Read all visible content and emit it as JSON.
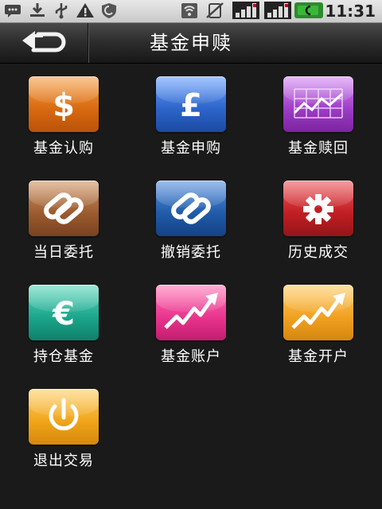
{
  "status_bar": {
    "time": "11:31",
    "icons": [
      "sms-icon",
      "download-icon",
      "usb-icon",
      "warning-icon",
      "shield-icon",
      "wifi-icon",
      "no-sim-icon",
      "signal-icon",
      "signal-2-icon",
      "battery-icon"
    ]
  },
  "header": {
    "title": "基金申赎",
    "back_icon": "back-arrow-icon"
  },
  "menu": {
    "items": [
      {
        "label": "基金认购",
        "icon": "dollar-icon",
        "color": "#e0781c"
      },
      {
        "label": "基金申购",
        "icon": "pound-icon",
        "color": "#2d67c9"
      },
      {
        "label": "基金赎回",
        "icon": "chart-grid-icon",
        "color": "#9d3fc4"
      },
      {
        "label": "当日委托",
        "icon": "link-icon",
        "color": "#9a5a2e"
      },
      {
        "label": "撤销委托",
        "icon": "link-icon",
        "color": "#1f5aa8"
      },
      {
        "label": "历史成交",
        "icon": "gear-icon",
        "color": "#bf1e23"
      },
      {
        "label": "持仓基金",
        "icon": "euro-icon",
        "color": "#1aa58a"
      },
      {
        "label": "基金账户",
        "icon": "trend-up-icon",
        "color": "#e8338c"
      },
      {
        "label": "基金开户",
        "icon": "trend-up-icon",
        "color": "#f0a020"
      },
      {
        "label": "退出交易",
        "icon": "power-icon",
        "color": "#f0a418"
      }
    ]
  }
}
